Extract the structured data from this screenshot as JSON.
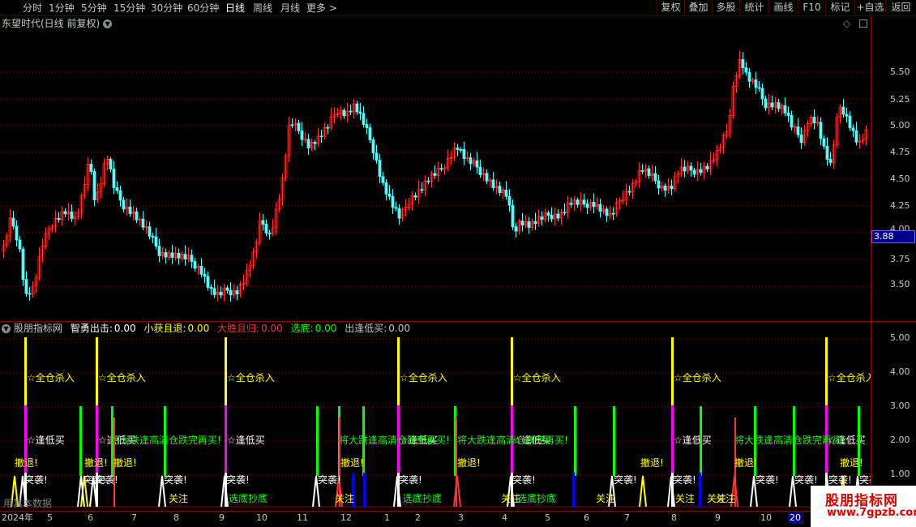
{
  "toolbar": {
    "periods": [
      "分时",
      "1分钟",
      "5分钟",
      "15分钟",
      "30分钟",
      "60分钟",
      "日线",
      "周线",
      "月线",
      "更多 >"
    ],
    "actions": [
      "复权",
      "叠加",
      "多股",
      "统计",
      "画线",
      "F10",
      "标记",
      "+自选",
      "返回"
    ]
  },
  "main_panel": {
    "title": "东望时代(日线 前复权)",
    "current_price": "3.88",
    "y_ticks": [
      "5.50",
      "5.25",
      "5.00",
      "4.75",
      "4.50",
      "4.25",
      "4.00",
      "3.75",
      "3.50"
    ]
  },
  "indicator_panel": {
    "title": "股朋指标网",
    "items": [
      {
        "label": "智勇出击:",
        "value": "0.00"
      },
      {
        "label": "小获且退:",
        "value": "0.00"
      },
      {
        "label": "大胜且归:",
        "value": "0.00"
      },
      {
        "label": "选底:",
        "value": "0.00"
      },
      {
        "label": "出逢低买:",
        "value": "0.00"
      }
    ],
    "y_ticks": [
      "5.00",
      "4.00",
      "3.00",
      "2.00",
      "1.00"
    ]
  },
  "signals": {
    "all_in": "☆全仓杀入",
    "buy_dip": "☆逢低买",
    "drop_buy": "将大跌逢高清仓跌完再买!",
    "retreat": "撤退!",
    "raid": "突袭!",
    "watch": "关注",
    "bottom": "选底抄底",
    "info": "用其本数据"
  },
  "dates": [
    "2024年",
    "5",
    "6",
    "7",
    "8",
    "9",
    "10",
    "11",
    "12",
    "1",
    "2",
    "3",
    "4",
    "5",
    "6",
    "7",
    "8",
    "9",
    "10",
    "20"
  ],
  "watermark": {
    "line1": "股朋指标网",
    "line2": "www.7gpzb.com"
  },
  "colors": {
    "up": "#ff3232",
    "down": "#54fcfc",
    "grid": "#8b0000",
    "yellow": "#ffff00",
    "magenta": "#ff00ff",
    "green": "#00ff00",
    "blue": "#0000ff",
    "white": "#ffffff"
  }
}
